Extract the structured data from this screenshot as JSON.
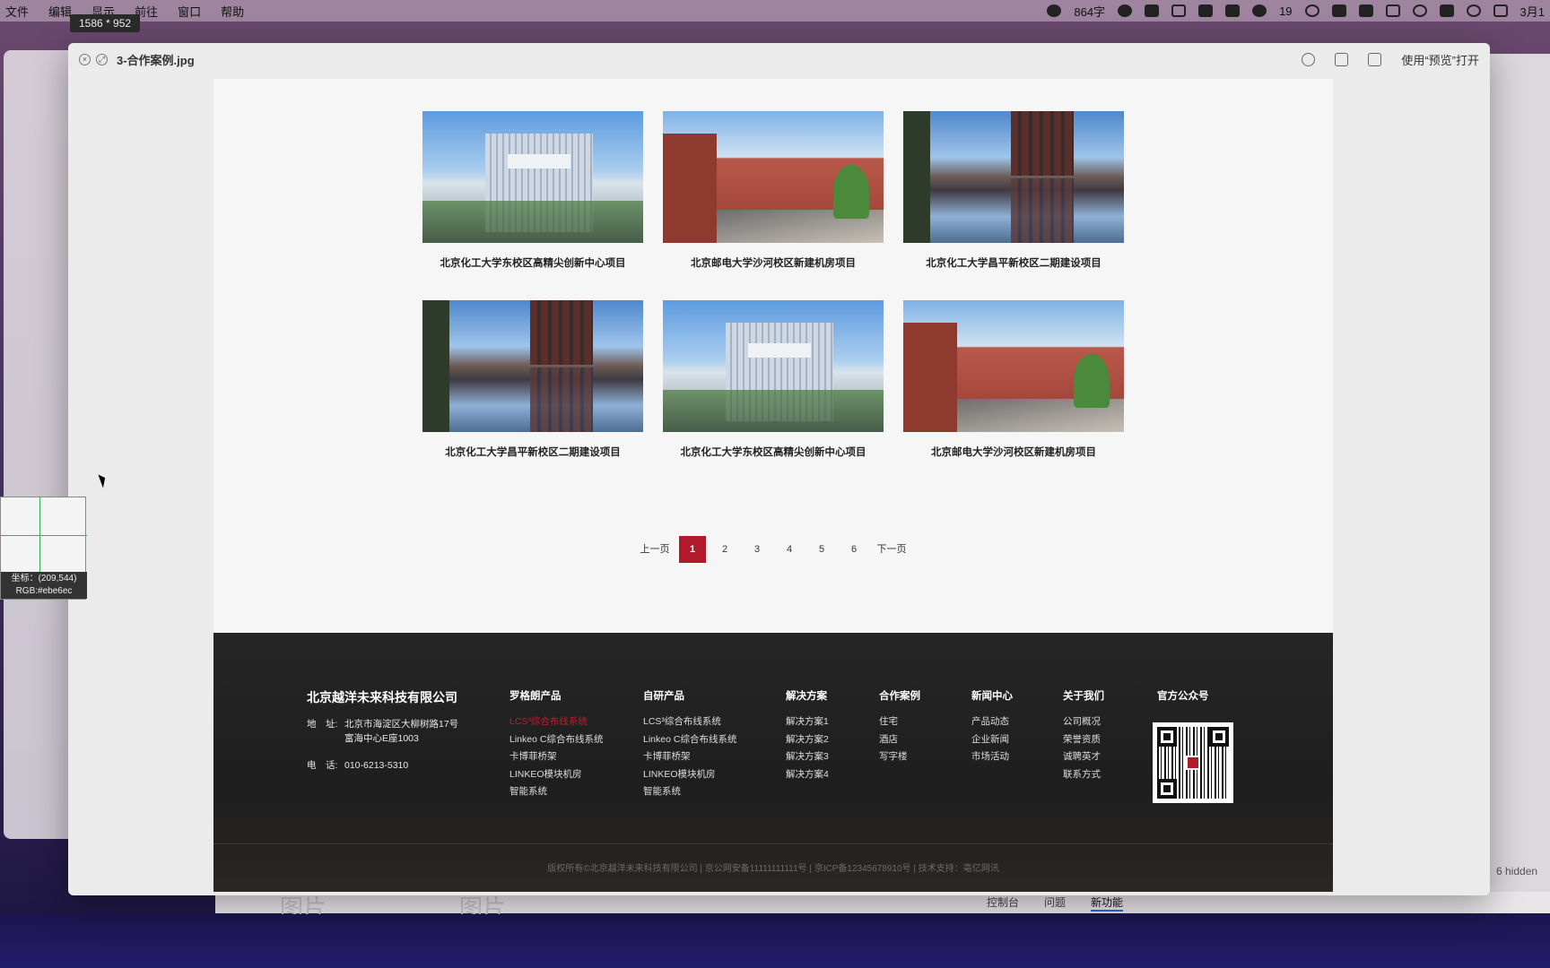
{
  "menubar": {
    "menus": [
      "文件",
      "编辑",
      "显示",
      "前往",
      "窗口",
      "帮助"
    ],
    "status": {
      "word_count": "864字",
      "wechat_count": "19",
      "date": "3月1"
    }
  },
  "dimension_badge": "1586 * 952",
  "window": {
    "filename": "3-合作案例.jpg",
    "open_with": "使用“预览”打开"
  },
  "projects": [
    {
      "title": "北京化工大学东校区高精尖创新中心项目"
    },
    {
      "title": "北京邮电大学沙河校区新建机房项目"
    },
    {
      "title": "北京化工大学昌平新校区二期建设项目"
    },
    {
      "title": "北京化工大学昌平新校区二期建设项目"
    },
    {
      "title": "北京化工大学东校区高精尖创新中心项目"
    },
    {
      "title": "北京邮电大学沙河校区新建机房项目"
    }
  ],
  "pagination": {
    "prev": "上一页",
    "pages": [
      "1",
      "2",
      "3",
      "4",
      "5",
      "6"
    ],
    "current": "1",
    "next": "下一页"
  },
  "footer": {
    "company_name": "北京越洋未来科技有限公司",
    "address_label": "地　址:",
    "address_line1": "北京市海淀区大柳树路17号",
    "address_line2": "富海中心E座1003",
    "phone_label": "电　话:",
    "phone": "010-6213-5310",
    "columns": [
      {
        "heading": "罗格朗产品",
        "items": [
          "LCS³综合布线系统",
          "Linkeo C综合布线系统",
          "卡博菲桥架",
          "LINKEO模块机房",
          "智能系统"
        ]
      },
      {
        "heading": "自研产品",
        "items": [
          "LCS³综合布线系统",
          "Linkeo C综合布线系统",
          "卡博菲桥架",
          "LINKEO模块机房",
          "智能系统"
        ]
      },
      {
        "heading": "解决方案",
        "items": [
          "解决方案1",
          "解决方案2",
          "解决方案3",
          "解决方案4"
        ]
      },
      {
        "heading": "合作案例",
        "items": [
          "住宅",
          "酒店",
          "写字楼"
        ]
      },
      {
        "heading": "新闻中心",
        "items": [
          "产品动态",
          "企业新闻",
          "市场活动"
        ]
      },
      {
        "heading": "关于我们",
        "items": [
          "公司概况",
          "荣誉资质",
          "诚聘英才",
          "联系方式"
        ]
      }
    ],
    "qr_heading": "官方公众号",
    "copyright": "版权所有©北京越洋未来科技有限公司 | 京公网安备11111111111号 | 京ICP备12345678910号 | 技术支持：亳亿网讯"
  },
  "color_picker": {
    "coords": "坐标：(209,544)",
    "rgb": "RGB:#ebe6ec"
  },
  "bottom_strip": {
    "tabs": [
      "控制台",
      "问题",
      "新功能"
    ],
    "hidden": "6 hidden",
    "ghost": "图片"
  },
  "colors": {
    "accent": "#b11a2b",
    "footer_bg": "#232323"
  }
}
